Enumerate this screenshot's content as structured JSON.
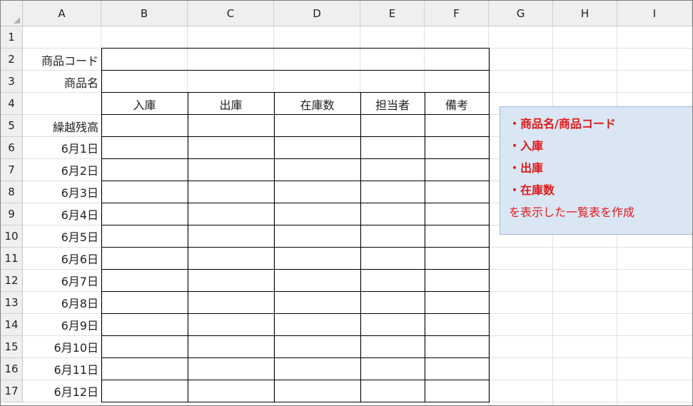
{
  "columns": [
    "A",
    "B",
    "C",
    "D",
    "E",
    "F",
    "G",
    "H",
    "I"
  ],
  "rows": [
    "1",
    "2",
    "3",
    "4",
    "5",
    "6",
    "7",
    "8",
    "9",
    "10",
    "11",
    "12",
    "13",
    "14",
    "15",
    "16",
    "17"
  ],
  "labels": {
    "product_code": "商品コード",
    "product_name": "商品名",
    "carryover": "繰越残高"
  },
  "table_headers": [
    "入庫",
    "出庫",
    "在庫数",
    "担当者",
    "備考"
  ],
  "dates": [
    "6月1日",
    "6月2日",
    "6月3日",
    "6月4日",
    "6月5日",
    "6月6日",
    "6月7日",
    "6月8日",
    "6月9日",
    "6月10日",
    "6月11日",
    "6月12日"
  ],
  "note": {
    "lines_bold": [
      "・商品名/商品コード",
      "・入庫",
      "・出庫",
      "・在庫数"
    ],
    "line_normal": "を表示した一覧表を作成"
  },
  "colors": {
    "header_bg": "#efefef",
    "note_bg": "#dae6f4",
    "note_text": "#e01b1b",
    "table_border": "#000000",
    "gridline": "#e0e0e0"
  }
}
